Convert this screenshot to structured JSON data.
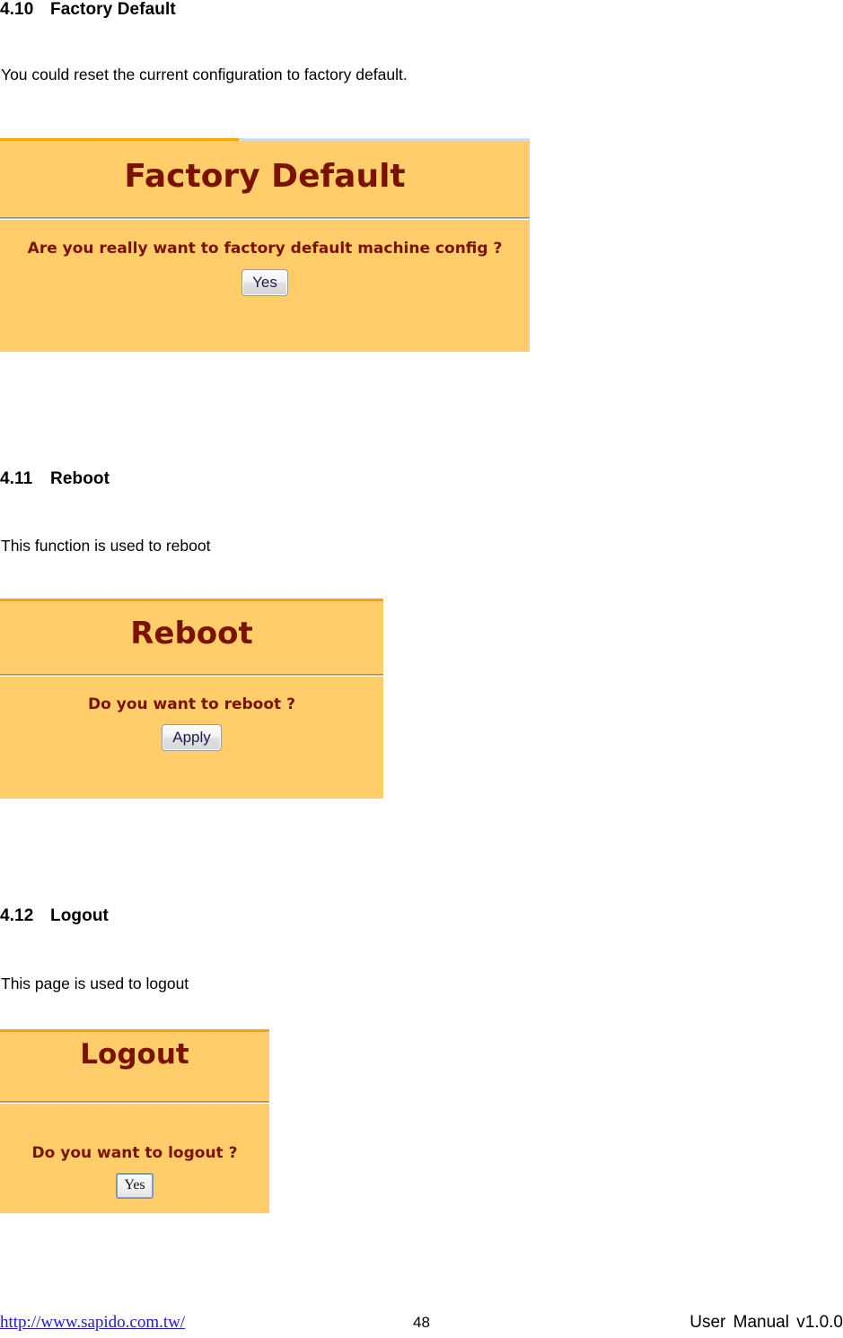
{
  "document": {
    "sections": [
      {
        "number": "4.10",
        "title": "Factory Default",
        "description": "You could reset the current configuration to factory default."
      },
      {
        "number": "4.11",
        "title": "Reboot",
        "description": "This function is used to reboot"
      },
      {
        "number": "4.12",
        "title": "Logout",
        "description": "This page is used to logout"
      }
    ],
    "screenshots": [
      {
        "panel_title": "Factory Default",
        "question": "Are you really want to factory default machine config ?",
        "button_label": "Yes"
      },
      {
        "panel_title": "Reboot",
        "question": "Do you want to reboot ?",
        "button_label": "Apply"
      },
      {
        "panel_title": "Logout",
        "question": "Do you want to logout ?",
        "button_label": "Yes"
      }
    ],
    "footer": {
      "url": "http://www.sapido.com.tw/",
      "page_number": "48",
      "manual": "User Manual v1.0.0"
    },
    "colors": {
      "panel_background": "#FFCE6B",
      "panel_top_border": "#FFA300",
      "panel_title_text": "#7A1200",
      "link": "#2020C8"
    }
  }
}
